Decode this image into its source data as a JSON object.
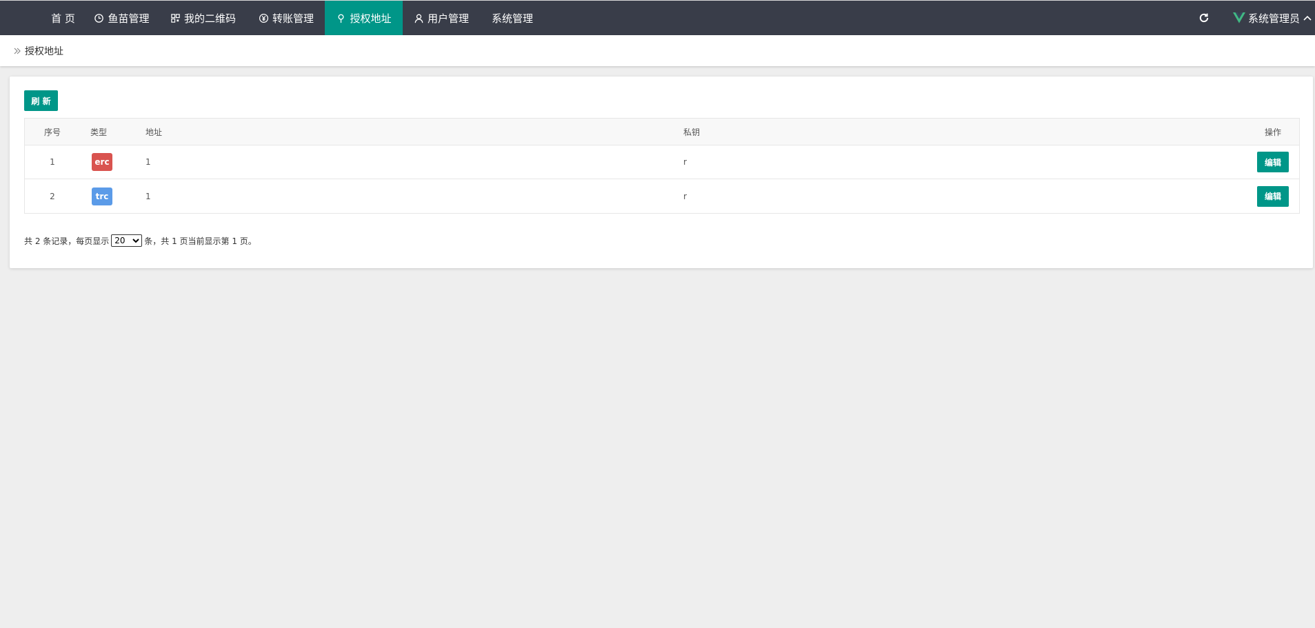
{
  "nav": {
    "items": [
      {
        "label": "首 页",
        "icon": "none"
      },
      {
        "label": "鱼苗管理",
        "icon": "clock-icon"
      },
      {
        "label": "我的二维码",
        "icon": "qrcode-icon"
      },
      {
        "label": "转账管理",
        "icon": "yen-icon"
      },
      {
        "label": "授权地址",
        "icon": "pin-icon"
      },
      {
        "label": "用户管理",
        "icon": "user-icon"
      },
      {
        "label": "系统管理",
        "icon": "none"
      }
    ],
    "active_label": "授权地址",
    "user_label": "系统管理员"
  },
  "breadcrumb": {
    "current": "授权地址"
  },
  "toolbar": {
    "refresh_label": "刷 新"
  },
  "table": {
    "headers": [
      "序号",
      "类型",
      "地址",
      "私钥",
      "操作"
    ],
    "rows": [
      {
        "index": "1",
        "type": "erc",
        "address": "1",
        "key": "r",
        "action": "编辑"
      },
      {
        "index": "2",
        "type": "trc",
        "address": "1",
        "key": "r",
        "action": "编辑"
      }
    ]
  },
  "pagination": {
    "prefix": "共 2 条记录，每页显示",
    "page_size": "20",
    "suffix": "条，共 1 页当前显示第 1 页。"
  },
  "colors": {
    "nav_bg": "#393d49",
    "accent": "#009688",
    "erc_badge": "#d9534f",
    "trc_badge": "#5b9be8"
  }
}
